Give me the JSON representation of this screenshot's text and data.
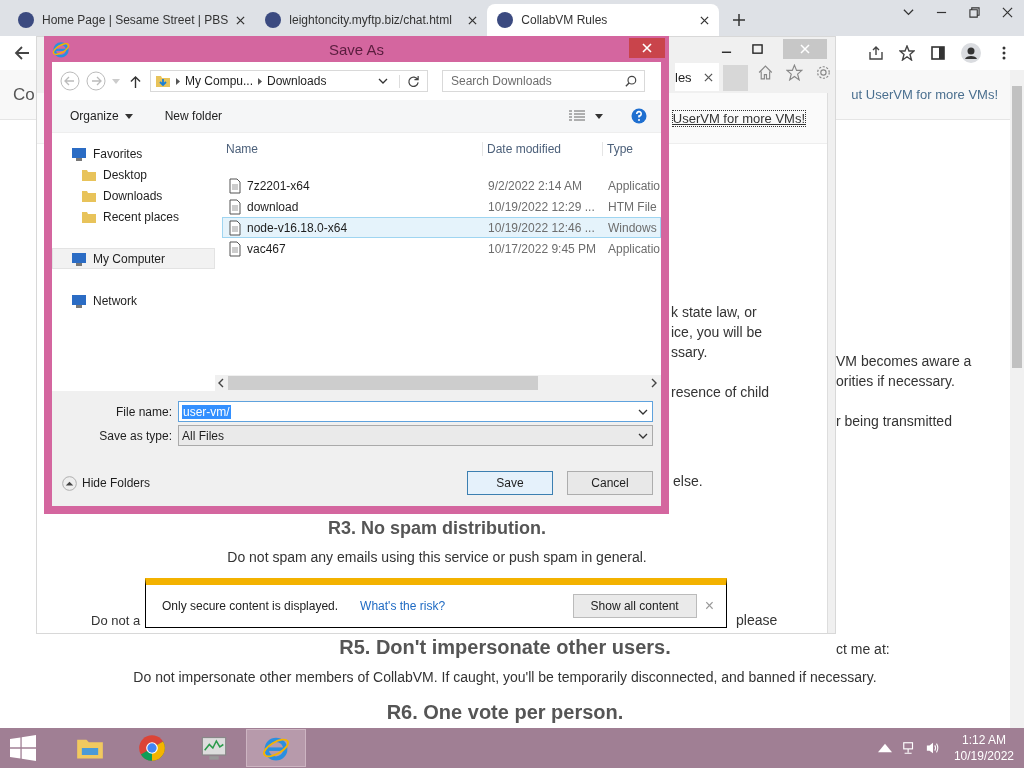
{
  "browser": {
    "tabs": [
      {
        "title": "Home Page | Sesame Street | PBS",
        "selected": false
      },
      {
        "title": "leightoncity.myftp.biz/chat.html",
        "selected": false
      },
      {
        "title": "CollabVM Rules",
        "selected": true
      }
    ]
  },
  "page": {
    "header_text": "Co",
    "header_link": "ut UserVM for more VMs!",
    "fragments": [
      "VM becomes aware a",
      "orities if necessary.",
      "r being transmitted",
      "ct me at:"
    ],
    "sections": [
      {
        "heading": "R5. Don't impersonate other users.",
        "text": "Do not impersonate other members of CollabVM. If caught, you'll be temporarily disconnected, and banned if necessary."
      },
      {
        "heading": "R6. One vote per person."
      }
    ]
  },
  "ie_window": {
    "tab_label": "les",
    "link": "UserVM for more VMs!",
    "fragments": [
      "k state law, or",
      "ice, you will be",
      "ssary.",
      "resence of child",
      "else."
    ],
    "heading": "R3. No spam distribution.",
    "paragraph": "Do not spam any emails using this service or push spam in general.",
    "line_start": "Do not a",
    "line_end": "please"
  },
  "save_dialog": {
    "title": "Save As",
    "breadcrumb": [
      "My Compu...",
      "Downloads"
    ],
    "search": {
      "placeholder": "Search Downloads"
    },
    "toolbar": [
      "Organize",
      "New folder"
    ],
    "nav": [
      {
        "label": "Favorites",
        "selected": false,
        "children": [
          {
            "label": "Desktop",
            "selected": false
          },
          {
            "label": "Downloads",
            "selected": false
          },
          {
            "label": "Recent places",
            "selected": false
          }
        ]
      },
      {
        "label": "My Computer",
        "selected": true
      },
      {
        "label": "Network",
        "selected": false
      }
    ],
    "columns": [
      "Name",
      "Date modified",
      "Type"
    ],
    "files": [
      {
        "name": "7z2201-x64",
        "date": "9/2/2022 2:14 AM",
        "type": "Applicatio",
        "selected": false
      },
      {
        "name": "download",
        "date": "10/19/2022 12:29 ...",
        "type": "HTM File",
        "selected": false
      },
      {
        "name": "node-v16.18.0-x64",
        "date": "10/19/2022 12:46 ...",
        "type": "Windows",
        "selected": true
      },
      {
        "name": "vac467",
        "date": "10/17/2022 9:45 PM",
        "type": "Applicatio",
        "selected": false
      }
    ],
    "file_name": {
      "label": "File name:",
      "value": "user-vm/"
    },
    "save_type": {
      "label": "Save as type:",
      "value": "All Files"
    },
    "hide_folders": "Hide Folders",
    "buttons": [
      "Save",
      "Cancel"
    ]
  },
  "notification": {
    "message": "Only secure content is displayed.",
    "link": "What's the risk?",
    "button": "Show all content",
    "close": "×"
  },
  "taskbar": {
    "apps": [
      {
        "kind": "explorer",
        "selected": false
      },
      {
        "kind": "chrome",
        "selected": false
      },
      {
        "kind": "monitor",
        "selected": false
      },
      {
        "kind": "ie",
        "selected": true
      }
    ],
    "time": "1:12 AM",
    "date": "10/19/2022"
  }
}
